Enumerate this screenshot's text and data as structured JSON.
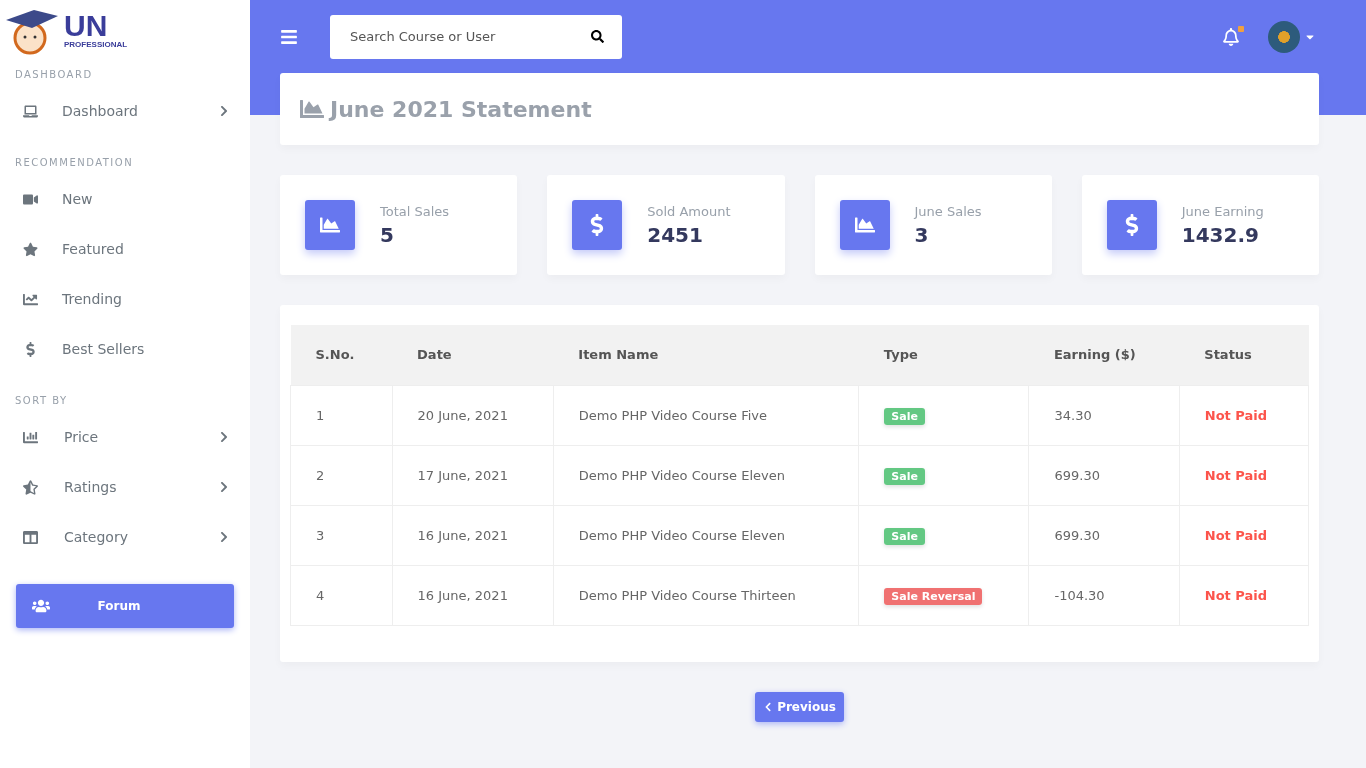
{
  "logo": {
    "title": "UN",
    "subtitle": "PROFESSIONAL"
  },
  "sidebar": {
    "groups": [
      {
        "heading": "DASHBOARD",
        "items": [
          {
            "label": "Dashboard",
            "expandable": true
          }
        ]
      },
      {
        "heading": "RECOMMENDATION",
        "items": [
          {
            "label": "New",
            "expandable": false
          },
          {
            "label": "Featured",
            "expandable": false
          },
          {
            "label": "Trending",
            "expandable": false
          },
          {
            "label": "Best Sellers",
            "expandable": false
          }
        ]
      },
      {
        "heading": "SORT BY",
        "items": [
          {
            "label": "Price",
            "expandable": true
          },
          {
            "label": "Ratings",
            "expandable": true
          },
          {
            "label": "Category",
            "expandable": true
          }
        ]
      }
    ],
    "forum_button": "Forum"
  },
  "topbar": {
    "search": {
      "placeholder": "Search Course or User"
    },
    "notification_dot": true
  },
  "statement": {
    "title": "June 2021 Statement"
  },
  "stats": [
    {
      "label": "Total Sales",
      "value": "5",
      "kind": "chart"
    },
    {
      "label": "Sold Amount",
      "value": "2451",
      "kind": "dollar"
    },
    {
      "label": "June Sales",
      "value": "3",
      "kind": "chart"
    },
    {
      "label": "June Earning",
      "value": "1432.9",
      "kind": "dollar"
    }
  ],
  "table": {
    "columns": [
      "S.No.",
      "Date",
      "Item Name",
      "Type",
      "Earning ($)",
      "Status"
    ],
    "rows": [
      {
        "sno": "1",
        "date": "20 June, 2021",
        "item": "Demo PHP Video Course Five",
        "type": {
          "label": "Sale",
          "kind": "sale"
        },
        "earning": "34.30",
        "status": {
          "label": "Not Paid",
          "kind": "unpaid"
        }
      },
      {
        "sno": "2",
        "date": "17 June, 2021",
        "item": "Demo PHP Video Course Eleven",
        "type": {
          "label": "Sale",
          "kind": "sale"
        },
        "earning": "699.30",
        "status": {
          "label": "Not Paid",
          "kind": "unpaid"
        }
      },
      {
        "sno": "3",
        "date": "16 June, 2021",
        "item": "Demo PHP Video Course Eleven",
        "type": {
          "label": "Sale",
          "kind": "sale"
        },
        "earning": "699.30",
        "status": {
          "label": "Not Paid",
          "kind": "unpaid"
        }
      },
      {
        "sno": "4",
        "date": "16 June, 2021",
        "item": "Demo PHP Video Course Thirteen",
        "type": {
          "label": "Sale Reversal",
          "kind": "reversal"
        },
        "earning": "-104.30",
        "status": {
          "label": "Not Paid",
          "kind": "unpaid"
        }
      }
    ]
  },
  "pagination": {
    "previous": "Previous"
  }
}
